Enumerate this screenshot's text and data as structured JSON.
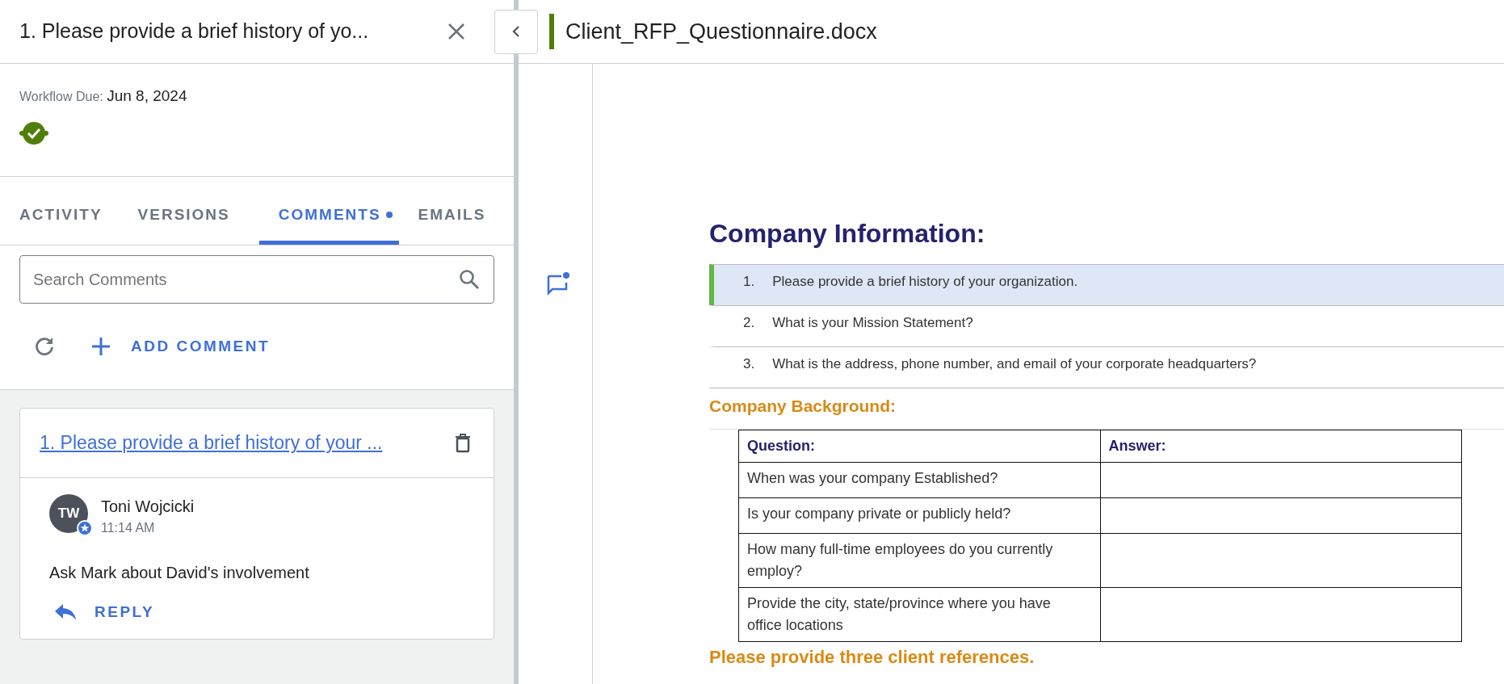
{
  "panel": {
    "title": "1. Please provide a brief history of yo...",
    "workflow_due_label": "Workflow Due:",
    "workflow_due_value": "Jun 8, 2024",
    "status_done": true
  },
  "tabs": [
    {
      "label": "ACTIVITY",
      "selected": false,
      "unread": false
    },
    {
      "label": "VERSIONS",
      "selected": false,
      "unread": false
    },
    {
      "label": "COMMENTS",
      "selected": true,
      "unread": true
    },
    {
      "label": "EMAILS",
      "selected": false,
      "unread": false
    }
  ],
  "search": {
    "placeholder": "Search Comments"
  },
  "add_comment": {
    "label": "ADD COMMENT"
  },
  "comments": [
    {
      "title": "1. Please provide a brief history of your ...",
      "author": "Toni Wojcicki",
      "initials": "TW",
      "time": "11:14 AM",
      "text": "Ask Mark about David's involvement",
      "reply_label": "REPLY",
      "unread": true
    }
  ],
  "document": {
    "filename": "Client_RFP_Questionnaire.docx",
    "heading": "Company Information:",
    "items": [
      {
        "number": "1.",
        "text": "Please provide a brief history of your organization.",
        "selected": true
      },
      {
        "number": "2.",
        "text": "What is your Mission Statement?",
        "selected": false
      },
      {
        "number": "3.",
        "text": "What is the address, phone number, and email of your corporate headquarters?",
        "selected": false
      }
    ],
    "section": "Company Background:",
    "table": {
      "columns": [
        "Question:",
        "Answer:"
      ],
      "rows": [
        [
          "When was your company Established?",
          ""
        ],
        [
          "Is your company private or publicly held?",
          ""
        ],
        [
          "How many full-time employees do you currently employ?",
          ""
        ],
        [
          "Provide the city, state/province where you have office locations",
          ""
        ]
      ]
    },
    "footer_heading": "Please provide three client references."
  }
}
